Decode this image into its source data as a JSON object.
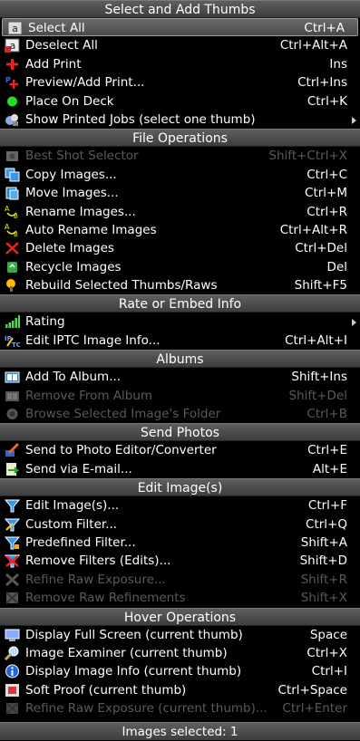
{
  "sections": [
    {
      "title": "Select and Add Thumbs",
      "items": [
        {
          "label": "Select All",
          "shortcut": "Ctrl+A",
          "icon": "select-all-icon",
          "selected": true
        },
        {
          "label": "Deselect All",
          "shortcut": "Ctrl+Alt+A",
          "icon": "deselect-all-icon"
        },
        {
          "label": "Add Print",
          "shortcut": "Ins",
          "icon": "add-print-icon"
        },
        {
          "label": "Preview/Add Print...",
          "shortcut": "Ctrl+Ins",
          "icon": "preview-add-print-icon"
        },
        {
          "label": "Place On Deck",
          "shortcut": "Ctrl+K",
          "icon": "place-on-deck-icon"
        },
        {
          "label": "Show Printed Jobs (select one thumb)",
          "shortcut": "",
          "icon": "printed-jobs-icon",
          "submenu": true
        }
      ]
    },
    {
      "title": "File Operations",
      "items": [
        {
          "label": "Best Shot Selector",
          "shortcut": "Shift+Ctrl+X",
          "icon": "best-shot-icon",
          "disabled": true
        },
        {
          "label": "Copy Images...",
          "shortcut": "Ctrl+C",
          "icon": "copy-images-icon"
        },
        {
          "label": "Move Images...",
          "shortcut": "Ctrl+M",
          "icon": "move-images-icon"
        },
        {
          "label": "Rename Images...",
          "shortcut": "Ctrl+R",
          "icon": "rename-images-icon"
        },
        {
          "label": "Auto Rename Images",
          "shortcut": "Ctrl+Alt+R",
          "icon": "auto-rename-icon"
        },
        {
          "label": "Delete Images",
          "shortcut": "Ctrl+Del",
          "icon": "delete-images-icon"
        },
        {
          "label": "Recycle Images",
          "shortcut": "Del",
          "icon": "recycle-images-icon"
        },
        {
          "label": "Rebuild Selected Thumbs/Raws",
          "shortcut": "Shift+F5",
          "icon": "rebuild-thumbs-icon"
        }
      ]
    },
    {
      "title": "Rate or Embed Info",
      "items": [
        {
          "label": "Rating",
          "shortcut": "",
          "icon": "rating-icon",
          "submenu": true
        },
        {
          "label": "Edit IPTC Image Info...",
          "shortcut": "Ctrl+Alt+I",
          "icon": "iptc-icon"
        }
      ]
    },
    {
      "title": "Albums",
      "items": [
        {
          "label": "Add To Album...",
          "shortcut": "Shift+Ins",
          "icon": "add-album-icon"
        },
        {
          "label": "Remove From Album",
          "shortcut": "Shift+Del",
          "icon": "remove-album-icon",
          "disabled": true
        },
        {
          "label": "Browse Selected Image's Folder",
          "shortcut": "Ctrl+B",
          "icon": "browse-folder-icon",
          "disabled": true
        }
      ]
    },
    {
      "title": "Send Photos",
      "items": [
        {
          "label": "Send to Photo Editor/Converter",
          "shortcut": "Ctrl+E",
          "icon": "photo-editor-icon"
        },
        {
          "label": "Send via E-mail...",
          "shortcut": "Alt+E",
          "icon": "email-icon"
        }
      ]
    },
    {
      "title": "Edit Image(s)",
      "items": [
        {
          "label": "Edit Image(s)...",
          "shortcut": "Ctrl+F",
          "icon": "edit-filter-icon"
        },
        {
          "label": "Custom Filter...",
          "shortcut": "Ctrl+Q",
          "icon": "custom-filter-icon"
        },
        {
          "label": "Predefined Filter...",
          "shortcut": "Shift+A",
          "icon": "predefined-filter-icon"
        },
        {
          "label": "Remove Filters (Edits)...",
          "shortcut": "Shift+D",
          "icon": "remove-filters-icon"
        },
        {
          "label": "Refine Raw Exposure...",
          "shortcut": "Shift+R",
          "icon": "refine-raw-icon",
          "disabled": true
        },
        {
          "label": "Remove Raw Refinements",
          "shortcut": "Shift+X",
          "icon": "remove-raw-icon",
          "disabled": true
        }
      ]
    },
    {
      "title": "Hover Operations",
      "items": [
        {
          "label": "Display Full Screen (current thumb)",
          "shortcut": "Space",
          "icon": "full-screen-icon"
        },
        {
          "label": "Image Examiner (current thumb)",
          "shortcut": "Ctrl+X",
          "icon": "examiner-icon"
        },
        {
          "label": "Display Image Info (current thumb)",
          "shortcut": "Ctrl+I",
          "icon": "image-info-icon"
        },
        {
          "label": "Soft Proof (current thumb)",
          "shortcut": "Ctrl+Space",
          "icon": "soft-proof-icon"
        },
        {
          "label": "Refine Raw Exposure (current thumb)...",
          "shortcut": "Ctrl+Enter",
          "icon": "refine-raw-hover-icon",
          "disabled": true
        }
      ]
    }
  ],
  "footer": {
    "status": "Images selected: 1"
  }
}
